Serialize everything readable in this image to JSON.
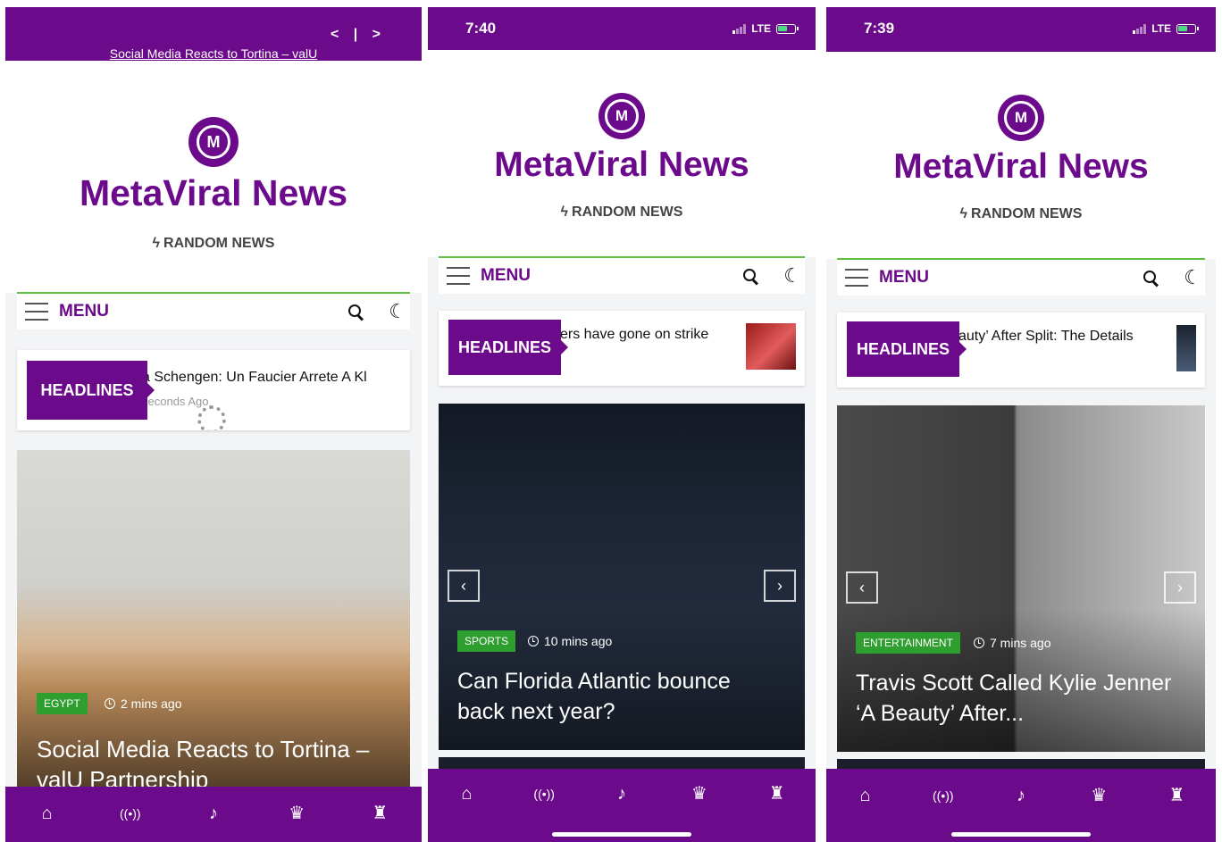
{
  "site": {
    "title": "MetaViral News",
    "random": "RANDOM NEWS",
    "menu": "MENU",
    "headlines": "HEADLINES"
  },
  "colors": {
    "brand": "#6b0a8a",
    "accent_green": "#2e9e2e",
    "divider": "#5fbf3f"
  },
  "icons": [
    "logo-icon",
    "bolt-icon",
    "hamburger-icon",
    "search-icon",
    "moon-icon",
    "clock-icon",
    "home-icon",
    "live-icon",
    "megaphone-icon",
    "trophy-icon",
    "gift-icon",
    "chevron-left-icon",
    "chevron-right-icon"
  ],
  "nav_glyphs": {
    "home": "⌂",
    "live": "((•))",
    "megaphone": "♪",
    "trophy": "♛",
    "gift": "♜",
    "prev": "‹",
    "next": "›",
    "moon": "☾",
    "bolt": "ϟ",
    "logo": "M"
  },
  "screens": [
    {
      "status": {
        "ticker_ctrl": "< | >",
        "ticker": "Social Media Reacts to Tortina – valU"
      },
      "headline": {
        "text": "a Schengen: Un Faucier Arrete A Kl",
        "sub": "seconds Ago"
      },
      "card": {
        "category": "EGYPT",
        "ago": "2 mins ago",
        "title": "Social Media Reacts to Tortina – valU Partnership"
      }
    },
    {
      "status": {
        "time": "7:40",
        "network": "LTE"
      },
      "headline": {
        "text": "ers have gone on strike"
      },
      "card": {
        "category": "SPORTS",
        "ago": "10 mins ago",
        "title": "Can Florida Atlantic bounce back next year?"
      }
    },
    {
      "status": {
        "time": "7:39",
        "network": "LTE"
      },
      "headline": {
        "text": "auty’ After Split: The Details"
      },
      "card": {
        "category": "ENTERTAINMENT",
        "ago": "7 mins ago",
        "title": "Travis Scott Called Kylie Jenner ‘A Beauty’ After..."
      }
    }
  ]
}
